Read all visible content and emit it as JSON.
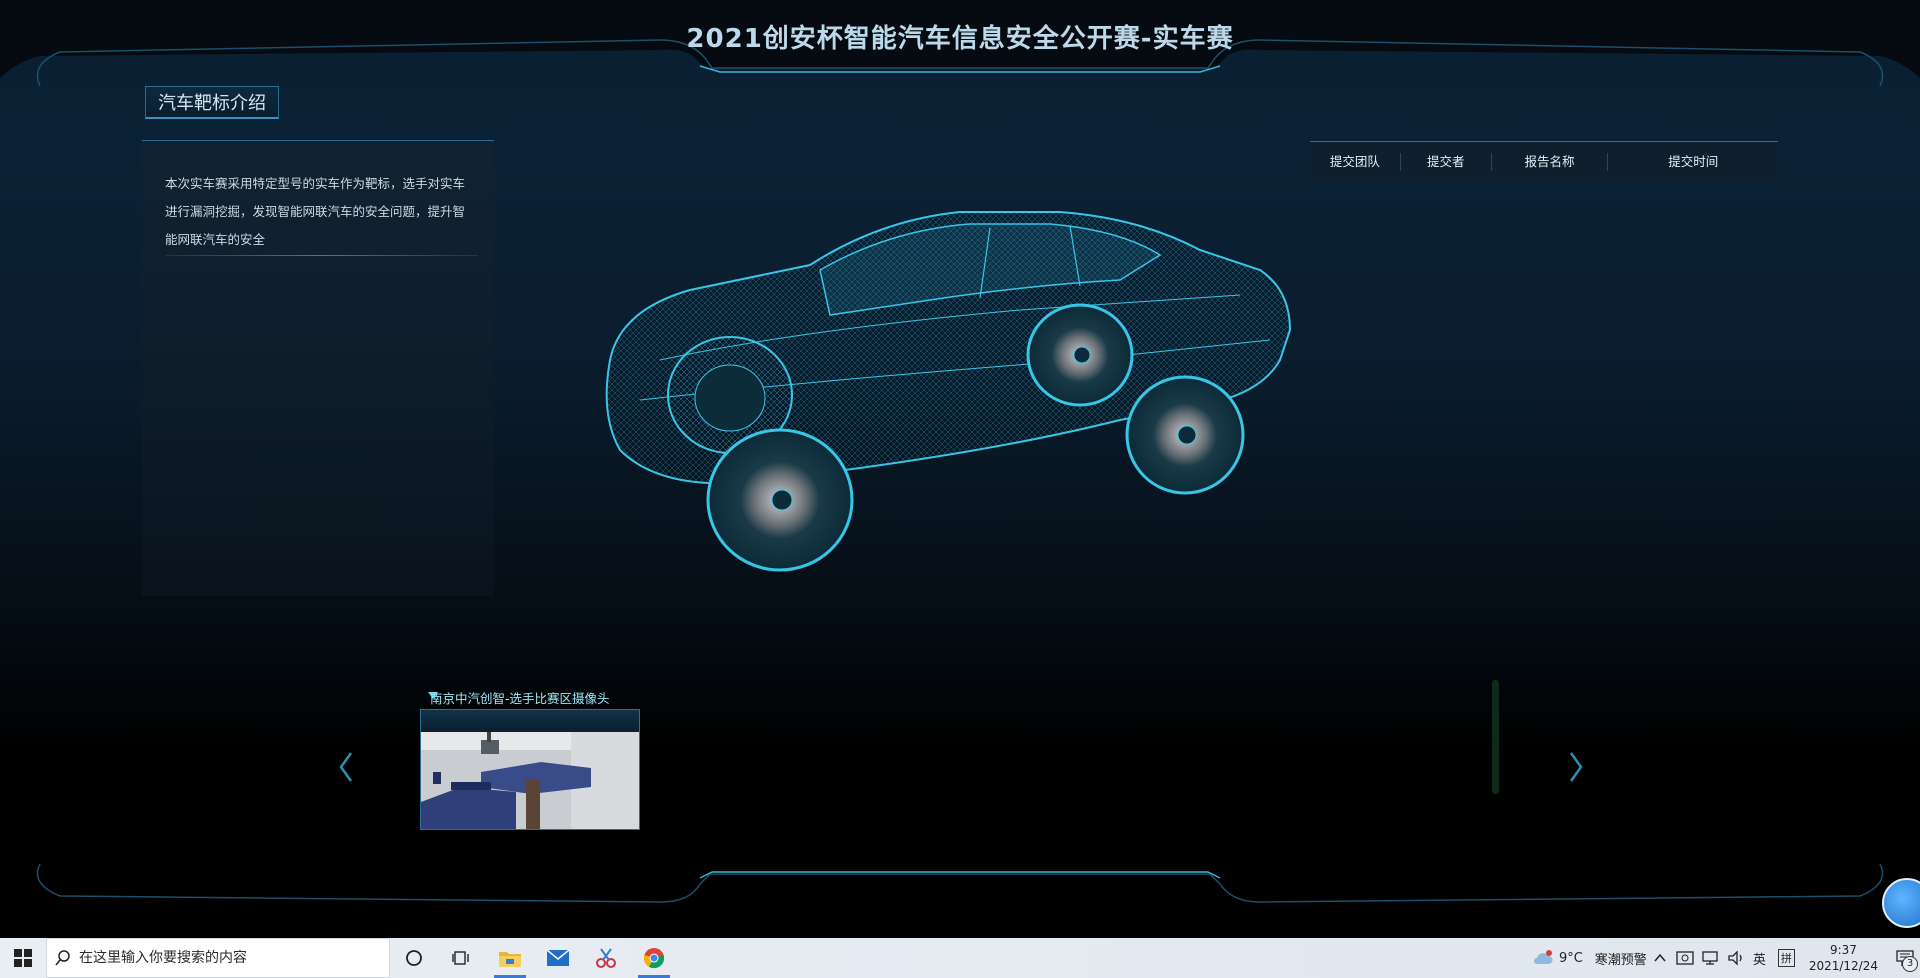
{
  "header": {
    "title": "2021创安杯智能汽车信息安全公开赛-实车赛"
  },
  "intro": {
    "tab_label": "汽车靶标介绍",
    "text": "本次实车赛采用特定型号的实车作为靶标，选手对实车进行漏洞挖掘，发现智能网联汽车的安全问题，提升智能网联汽车的安全"
  },
  "submission_table": {
    "columns": [
      "提交团队",
      "提交者",
      "报告名称",
      "提交时间"
    ]
  },
  "camera": {
    "caption": "南京中汽创智-选手比赛区摄像头"
  },
  "taskbar": {
    "search_placeholder": "在这里输入你要搜索的内容",
    "weather": "9°C",
    "weather_alert": "寒潮预警",
    "ime_lang": "英",
    "ime_mode": "拼",
    "time": "9:37",
    "date": "2021/12/24",
    "notification_count": "3"
  },
  "colors": {
    "accent": "#3fb8d8",
    "wire": "#39c6e6",
    "title": "#bcd9ea"
  }
}
